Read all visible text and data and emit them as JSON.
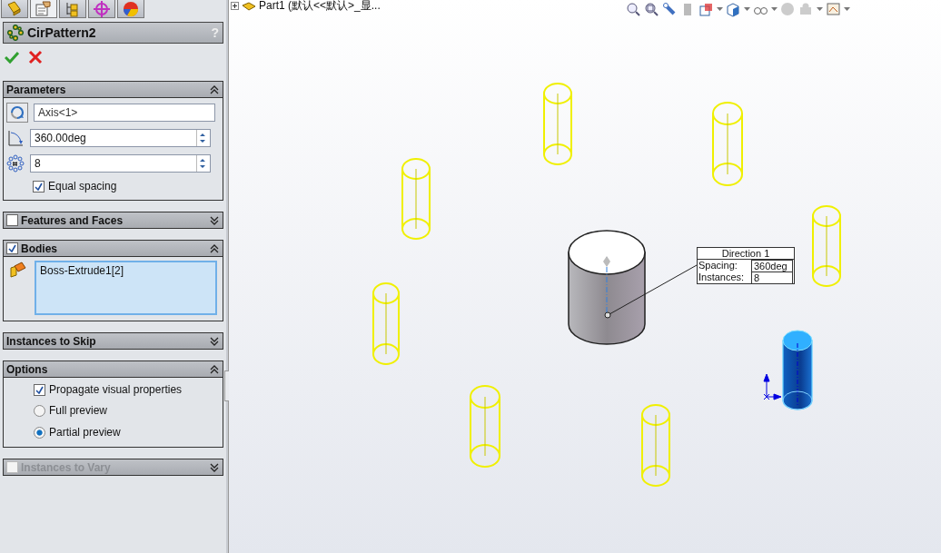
{
  "tabs": [
    {
      "kind": "feature-tree",
      "selected": false
    },
    {
      "kind": "property",
      "selected": true
    },
    {
      "kind": "configuration",
      "selected": false
    },
    {
      "kind": "dimxpert",
      "selected": false
    },
    {
      "kind": "display",
      "selected": false
    }
  ],
  "property_manager": {
    "title": "CirPattern2",
    "help": "?"
  },
  "sections": [
    {
      "kind": "parameters",
      "title": "Parameters",
      "expanded": true,
      "axis": "Axis<1>",
      "angle": "360.00deg",
      "count": "8",
      "equal_spacing": {
        "label": "Equal spacing",
        "checked": true
      }
    },
    {
      "title": "Features and Faces",
      "checked": false,
      "expanded": false
    },
    {
      "kind": "bodies",
      "title": "Bodies",
      "checked": true,
      "expanded": true,
      "bodies": [
        "Boss-Extrude1[2]"
      ]
    },
    {
      "title": "Instances to Skip",
      "expanded": false
    },
    {
      "kind": "options",
      "title": "Options",
      "expanded": true,
      "propagate": {
        "label": "Propagate visual properties",
        "checked": true
      },
      "preview": [
        {
          "label": "Full preview",
          "selected": false
        },
        {
          "label": "Partial preview",
          "selected": true
        }
      ]
    },
    {
      "title": "Instances to Vary",
      "checked": false,
      "disabled": true,
      "expanded": false
    }
  ],
  "viewport": {
    "breadcrumb": "Part1 (默认<<默认>_显...",
    "callout": {
      "title": "Direction 1",
      "rows": [
        {
          "label": "Spacing:",
          "value": "360deg"
        },
        {
          "label": "Instances:",
          "value": "8"
        }
      ]
    }
  }
}
